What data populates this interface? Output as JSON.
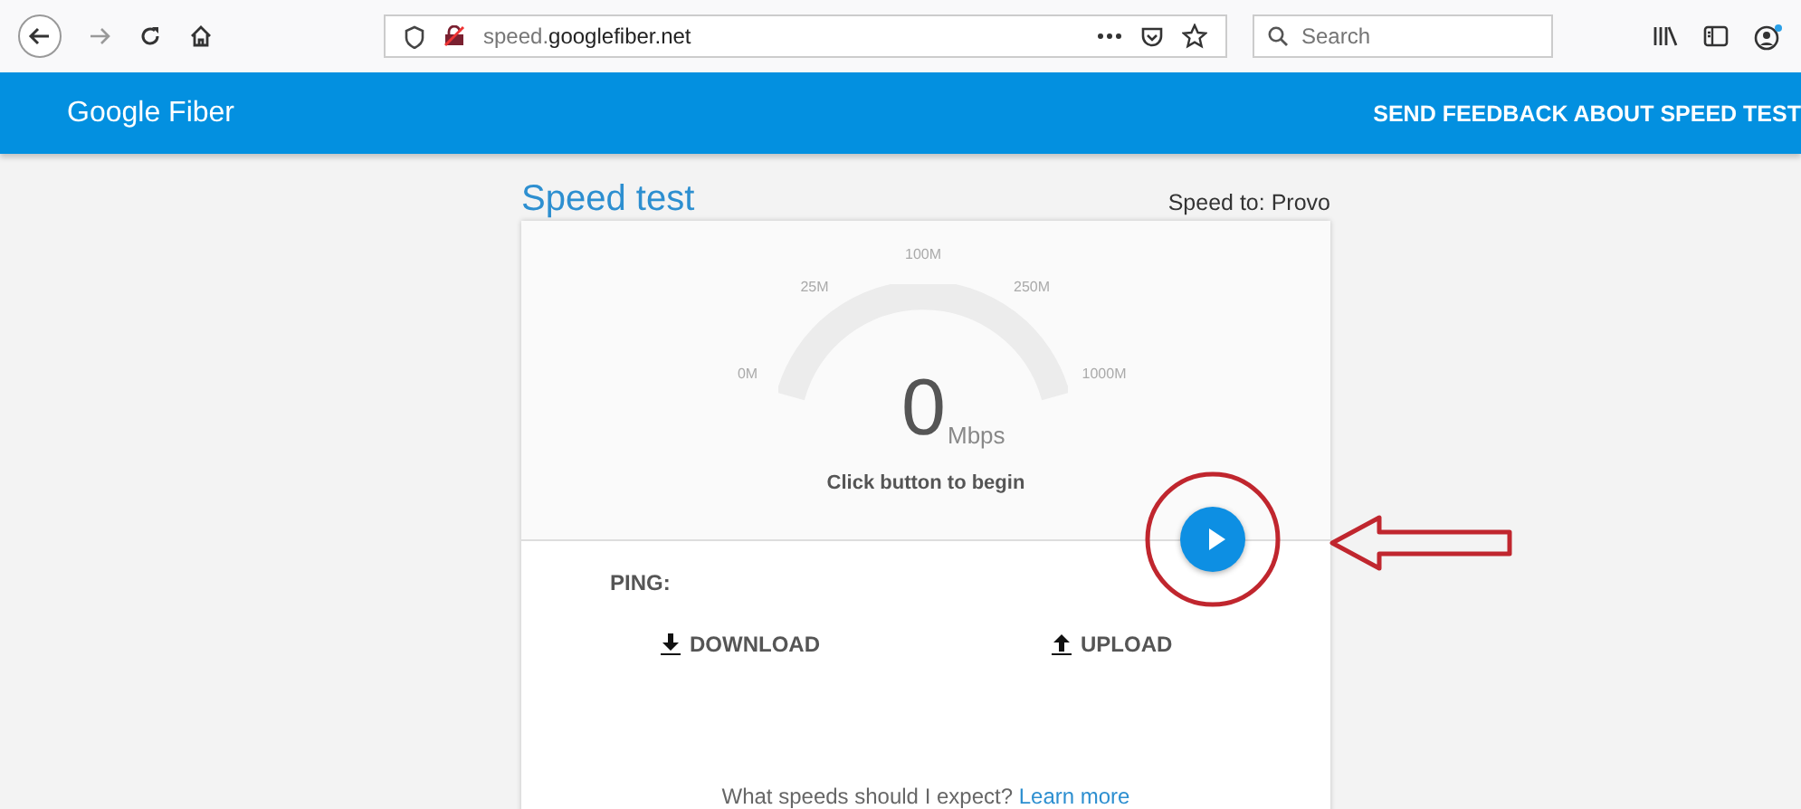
{
  "browser": {
    "url": "speed.**googlefiber.net**",
    "search": {
      "placeholder": "Search"
    }
  },
  "header": {
    "logo": "Google Fiber",
    "feedback_link": "SEND FEEDBACK ABOUT SPEED TEST"
  },
  "page": {
    "title": "Speed test",
    "server": "Speed to: Provo"
  },
  "gauge": {
    "ticks": [
      {
        "label": "0M"
      },
      {
        "label": "25M"
      },
      {
        "label": "100M"
      },
      {
        "label": "250M"
      },
      {
        "label": "1000M"
      }
    ],
    "value": "0",
    "unit": "Mbps",
    "status": "Click button to begin"
  },
  "results": {
    "ping": "PING:",
    "download": "DOWNLOAD",
    "upload": "UPLOAD"
  },
  "footer": {
    "question": "What speeds should I expect?",
    "link": "Learn more"
  }
}
